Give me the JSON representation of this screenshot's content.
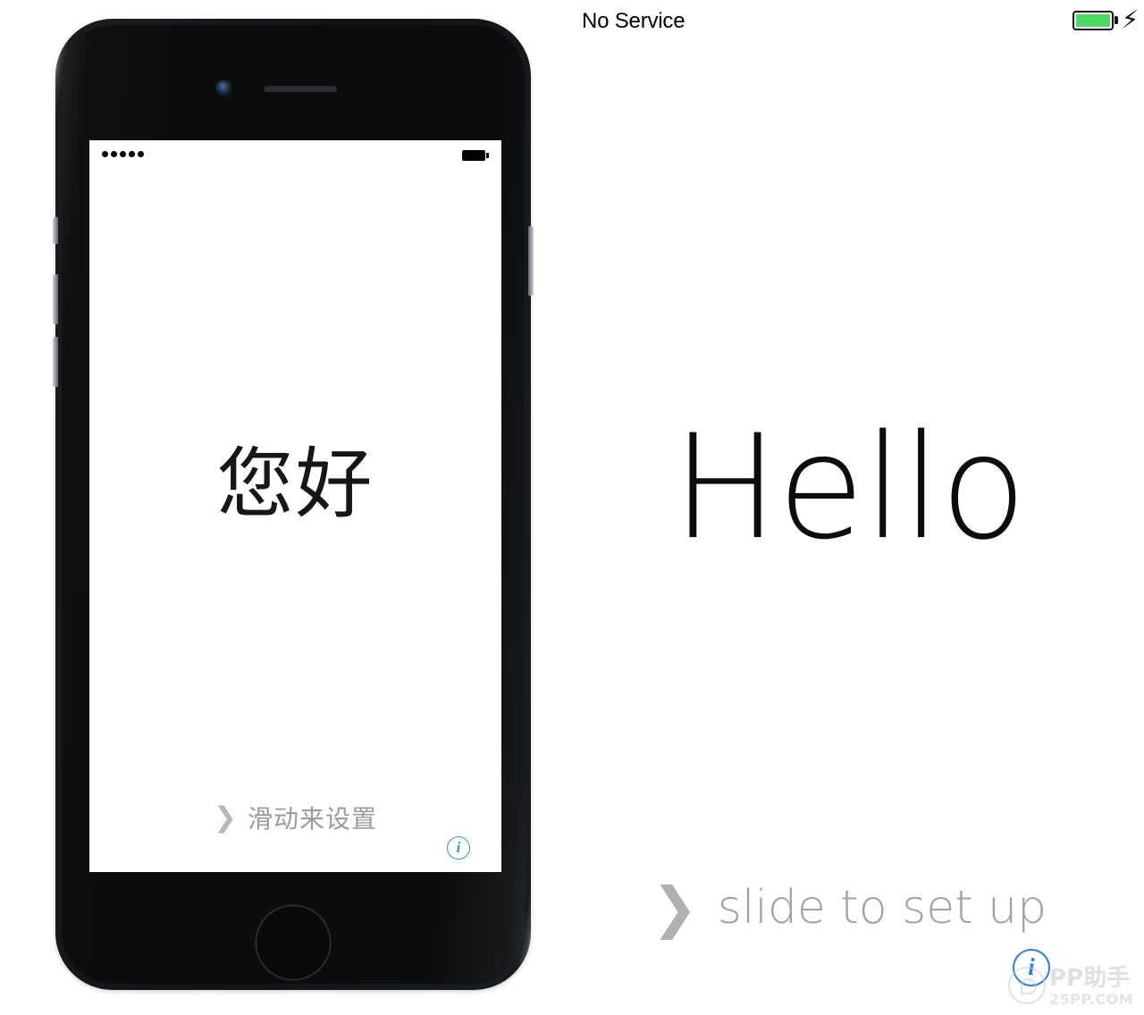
{
  "status_bar": {
    "carrier": "No Service",
    "battery_icon": "battery-full-icon",
    "battery_color": "#4cd964",
    "charging_icon": "lightning-bolt-icon",
    "charging_glyph": "⚡"
  },
  "phone": {
    "device_name": "iphone-space-gray",
    "screen": {
      "status_bar": {
        "signal_dots": 5,
        "battery_icon": "battery-full-dark-icon"
      },
      "greeting": "您好",
      "slide": {
        "chevron": "❯",
        "label": "滑动来设置"
      },
      "info_button_glyph": "i"
    },
    "hardware": {
      "camera": "front-camera",
      "speaker": "earpiece-speaker",
      "home_button": "home-button",
      "mute_switch": "mute-switch",
      "volume_up": "volume-up-button",
      "volume_down": "volume-down-button",
      "power": "power-button"
    }
  },
  "setup_panel": {
    "greeting": "Hello",
    "slide": {
      "chevron": "❯",
      "label": "slide to set up"
    },
    "info_button_glyph": "i",
    "accent_color": "#2e7ee0"
  },
  "watermark": {
    "brand": "PP助手",
    "domain": "25PP.COM"
  }
}
